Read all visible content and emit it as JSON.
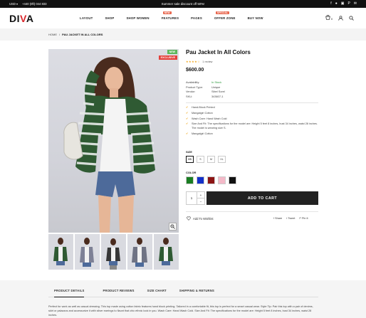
{
  "topbar": {
    "currency": "USD ▾",
    "phone": "+440 (0ft) 044 833",
    "promo": "Summer sale discount off 50%!",
    "social": [
      "f",
      "ὂ6",
      "▣",
      "P",
      "✉"
    ]
  },
  "header": {
    "logo_main": "DI",
    "logo_accent": "V",
    "logo_end": "A",
    "nav": [
      {
        "label": "LAYOUT",
        "tag": ""
      },
      {
        "label": "SHOP",
        "tag": ""
      },
      {
        "label": "SHOP WOMEN",
        "tag": ""
      },
      {
        "label": "FEATURES",
        "tag": "NEW"
      },
      {
        "label": "PAGES",
        "tag": ""
      },
      {
        "label": "OFFER ZONE",
        "tag": "SPECIAL"
      },
      {
        "label": "BUY NOW",
        "tag": ""
      }
    ],
    "cart_count": "0"
  },
  "breadcrumb": {
    "home": "HOME",
    "sep": "/",
    "current": "PAU JACKET IN ALL COLORS"
  },
  "badges": {
    "new": "NEW",
    "exclusive": "EXCLUSIVE"
  },
  "product": {
    "title": "Pau Jacket In All Colors",
    "stars": "★★★★☆",
    "reviews": "1 review",
    "price": "$600.00",
    "specs": [
      {
        "k": "Availability:",
        "v": "In Stock"
      },
      {
        "k": "Product Type:",
        "v": "Unique"
      },
      {
        "k": "Vendor:",
        "v": "Sibel Sorel"
      },
      {
        "k": "SKU:",
        "v": "343607-1"
      }
    ],
    "features": [
      "Hand-Block Printed",
      "Mangalgiri Cotton",
      "Wash Care: Hand Wash Cold",
      "Size And Fit: The specifications for the model are: Height 5 feet 8 inches, bust 34 inches, waist 28 inches. The model is wearing size S.",
      "Mangalgiri Cotton"
    ],
    "size_label": "SIZE",
    "sizes": [
      "XS",
      "S",
      "M",
      "XL"
    ],
    "color_label": "COLOR",
    "colors": [
      "#1a7d22",
      "#1330c9",
      "#8c1414",
      "#f4b9c8",
      "#111111"
    ],
    "quantity": "1",
    "add_to_cart": "ADD TO CART",
    "wishlist": "Add To Wishlist",
    "share": [
      {
        "icon": "f",
        "label": "Share"
      },
      {
        "icon": "t",
        "label": "Tweet"
      },
      {
        "icon": "P",
        "label": "Pin It"
      }
    ]
  },
  "tabs": [
    "PRODUCT DETAILS",
    "PRODUCT REVIEWS",
    "SIZE CHART",
    "SHIPPING & RETURNS"
  ],
  "description": "Perfect for work as well as casual dressing. This top made using cotton fabric features hand block printing. Tailored in a comfortable fit, this top is perfect for a smart casual wear. Style Tip: Pair this top with a pair of denims, skirt or palazzos and accessorize it with silver earrings to flaunt that chic ethnic look in you. Wash Care: Hand Wash Cold. Size And Fit: The specifications for the model are: Height 5 feet 8 inches, bust 34 inches, waist 28 inches."
}
